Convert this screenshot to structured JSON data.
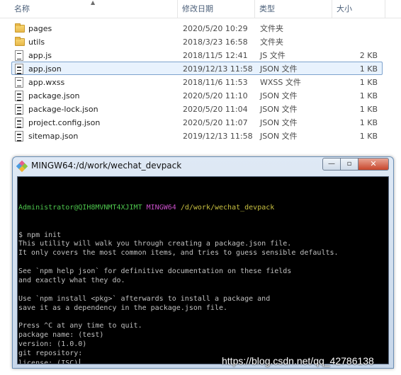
{
  "explorer": {
    "columns": {
      "name": "名称",
      "date": "修改日期",
      "type": "类型",
      "size": "大小"
    },
    "files": [
      {
        "name": "pages",
        "date": "2020/5/20 10:29",
        "type": "文件夹",
        "size": "",
        "icon": "folder-icon"
      },
      {
        "name": "utils",
        "date": "2018/3/23 16:58",
        "type": "文件夹",
        "size": "",
        "icon": "folder-icon"
      },
      {
        "name": "app.js",
        "date": "2018/11/5 12:41",
        "type": "JS 文件",
        "size": "2 KB",
        "icon": "js-file-icon"
      },
      {
        "name": "app.json",
        "date": "2019/12/13 11:58",
        "type": "JSON 文件",
        "size": "1 KB",
        "icon": "json-file-icon"
      },
      {
        "name": "app.wxss",
        "date": "2018/11/6 11:53",
        "type": "WXSS 文件",
        "size": "1 KB",
        "icon": "file-icon"
      },
      {
        "name": "package.json",
        "date": "2020/5/20 11:10",
        "type": "JSON 文件",
        "size": "1 KB",
        "icon": "json-file-icon"
      },
      {
        "name": "package-lock.json",
        "date": "2020/5/20 11:04",
        "type": "JSON 文件",
        "size": "1 KB",
        "icon": "json-file-icon"
      },
      {
        "name": "project.config.json",
        "date": "2020/5/20 11:07",
        "type": "JSON 文件",
        "size": "1 KB",
        "icon": "json-file-icon"
      },
      {
        "name": "sitemap.json",
        "date": "2019/12/13 11:58",
        "type": "JSON 文件",
        "size": "1 KB",
        "icon": "json-file-icon"
      }
    ]
  },
  "terminal_window": {
    "title": "MINGW64:/d/work/wechat_devpack",
    "prompt": {
      "user_host": "Administrator@QIH8MVNMT4XJIMT",
      "system": "MINGW64",
      "path": "/d/work/wechat_devpack"
    },
    "lines": [
      "$ npm init",
      "This utility will walk you through creating a package.json file.",
      "It only covers the most common items, and tries to guess sensible defaults.",
      "",
      "See `npm help json` for definitive documentation on these fields",
      "and exactly what they do.",
      "",
      "Use `npm install <pkg>` afterwards to install a package and",
      "save it as a dependency in the package.json file.",
      "",
      "Press ^C at any time to quit.",
      "package name: (test)",
      "version: (1.0.0)",
      "git repository:",
      "license: (ISC)"
    ],
    "buttons": {
      "minimize": "—",
      "maximize": "▫",
      "close": "✕"
    }
  },
  "watermark": "https://blog.csdn.net/qq_42786138",
  "colors": {
    "selection": "#e8f2fd",
    "selection_border": "#7da2ce",
    "prompt_user": "#4cc44c",
    "prompt_system": "#c94fc9",
    "prompt_path": "#c8c040"
  }
}
